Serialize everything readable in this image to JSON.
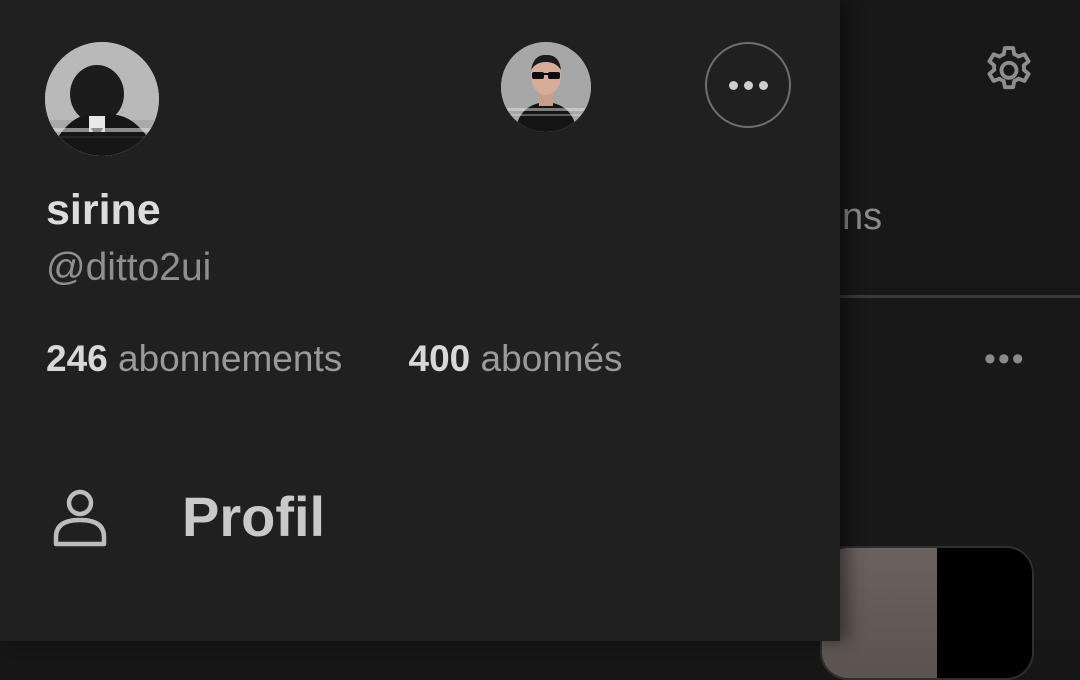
{
  "background": {
    "tab_fragment": "ns",
    "icons": {
      "settings": "gear-icon",
      "more": "more-horizontal-icon"
    }
  },
  "drawer": {
    "profile": {
      "name": "sirine",
      "handle": "@ditto2ui"
    },
    "stats": {
      "following_count": "246",
      "following_label": "abonnements",
      "followers_count": "400",
      "followers_label": "abonnés"
    },
    "menu": [
      {
        "label": "Profil",
        "icon": "person-icon"
      }
    ]
  }
}
